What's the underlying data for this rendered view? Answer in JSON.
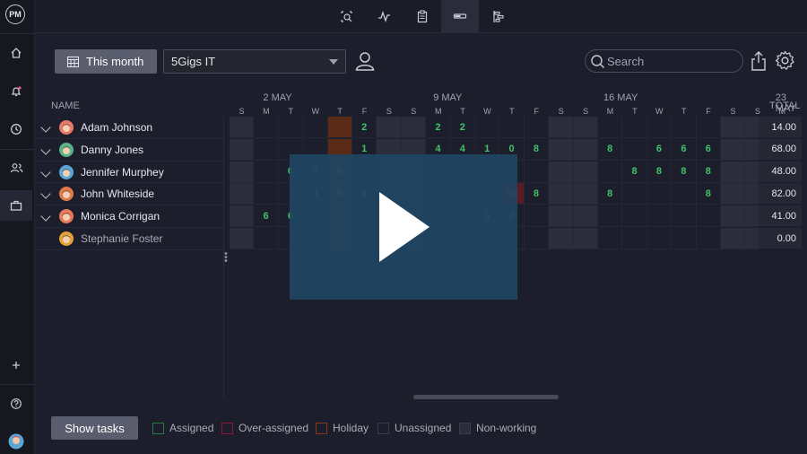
{
  "app": {
    "logo": "PM"
  },
  "rail": {
    "icons": [
      "home-icon",
      "bell-icon",
      "clock-icon",
      "team-icon",
      "briefcase-icon",
      "plus-icon",
      "help-icon",
      "user-avatar"
    ]
  },
  "topbar": {
    "icons": [
      "board-search-icon",
      "pulse-icon",
      "clipboard-icon",
      "workload-icon",
      "gantt-icon"
    ]
  },
  "toolbar": {
    "month_label": "This month",
    "project_select": "5Gigs IT",
    "search_placeholder": "Search"
  },
  "grid": {
    "name_header": "NAME",
    "total_header": "TOTAL",
    "weeks": [
      "2 MAY",
      "9 MAY",
      "16 MAY",
      "23 MAY"
    ],
    "days": [
      "S",
      "M",
      "T",
      "W",
      "T",
      "F",
      "S",
      "S",
      "M",
      "T",
      "W",
      "T",
      "F",
      "S",
      "S",
      "M",
      "T",
      "W",
      "T",
      "F",
      "S",
      "S",
      "M"
    ],
    "people": [
      {
        "name": "Adam Johnson",
        "color": "#e97a6a",
        "total": "14.00",
        "cells": {
          "5": "2",
          "8": "2",
          "9": "2"
        }
      },
      {
        "name": "Danny Jones",
        "color": "#5ab48a",
        "total": "68.00",
        "cells": {
          "5": "1",
          "8": "4",
          "9": "4",
          "10": "1",
          "11": "0",
          "12": "8",
          "15": "8",
          "17": "6",
          "18": "6",
          "19": "6"
        }
      },
      {
        "name": "Jennifer Murphey",
        "color": "#5aa7d6",
        "total": "48.00",
        "cells": {
          "2": "0",
          "3": "0",
          "4": "0",
          "16": "8",
          "17": "8",
          "18": "8",
          "19": "8"
        }
      },
      {
        "name": "John Whiteside",
        "color": "#e07a4a",
        "total": "82.00",
        "cells": {
          "3": "4",
          "4": "0",
          "5": "4",
          "11": "10",
          "12": "8",
          "15": "8",
          "19": "8"
        }
      },
      {
        "name": "Monica Corrigan",
        "color": "#e87b5a",
        "total": "41.00",
        "cells": {
          "1": "6",
          "2": "6",
          "10": "3",
          "11": "2"
        }
      },
      {
        "name": "Stephanie Foster",
        "color": "#e0a43a",
        "total": "0.00",
        "cells": {}
      }
    ]
  },
  "footer": {
    "show_tasks": "Show tasks",
    "legend": [
      {
        "label": "Assigned",
        "color": "#2a7a44"
      },
      {
        "label": "Over-assigned",
        "color": "#8a1a33"
      },
      {
        "label": "Holiday",
        "color": "#8a3c1a"
      },
      {
        "label": "Unassigned",
        "color": "#3a3c4c"
      },
      {
        "label": "Non-working",
        "color": "#3a3c4c"
      }
    ]
  }
}
